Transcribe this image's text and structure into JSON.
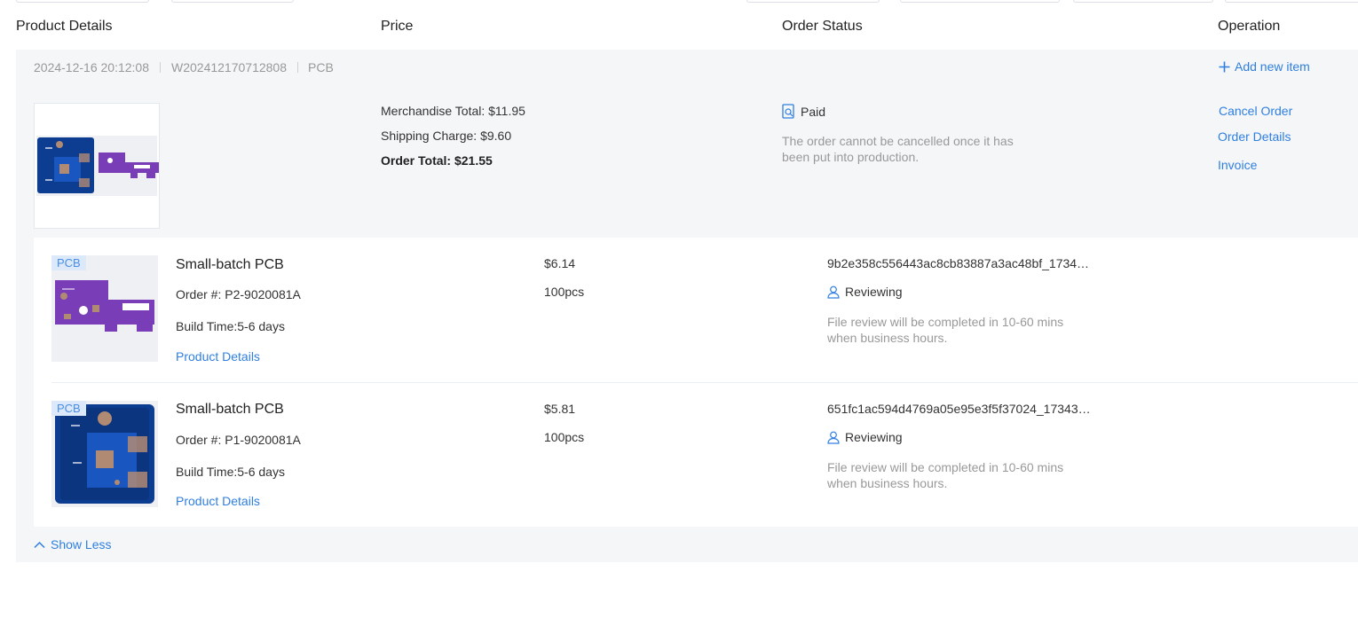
{
  "columns": {
    "product": "Product Details",
    "price": "Price",
    "status": "Order Status",
    "operation": "Operation"
  },
  "order": {
    "datetime": "2024-12-16 20:12:08",
    "number": "W202412170712808",
    "category": "PCB",
    "add_item": "Add new item",
    "merch_total": "Merchandise Total: $11.95",
    "shipping": "Shipping Charge: $9.60",
    "order_total": "Order Total: $21.55",
    "status": "Paid",
    "status_note": "The order cannot be cancelled once it has been put into production.",
    "ops": {
      "cancel": "Cancel Order",
      "details": "Order Details",
      "invoice": "Invoice"
    }
  },
  "items": [
    {
      "badge": "PCB",
      "title": "Small-batch PCB",
      "order_no": "Order #: P2-9020081A",
      "build_time": "Build Time:5-6 days",
      "details_link": "Product Details",
      "price": "$6.14",
      "qty": "100pcs",
      "file": "9b2e358c556443ac8cb83887a3ac48bf_1734…",
      "status": "Reviewing",
      "note": "File review will be completed in 10-60 mins when business hours.",
      "board_color": "#7a3db8"
    },
    {
      "badge": "PCB",
      "title": "Small-batch PCB",
      "order_no": "Order #: P1-9020081A",
      "build_time": "Build Time:5-6 days",
      "details_link": "Product Details",
      "price": "$5.81",
      "qty": "100pcs",
      "file": "651fc1ac594d4769a05e95e3f5f37024_17343…",
      "status": "Reviewing",
      "note": "File review will be completed in 10-60 mins when business hours.",
      "board_color": "#0d3d91"
    }
  ],
  "show_less": "Show Less",
  "colors": {
    "link": "#2f7fe0",
    "muted": "#999999",
    "block_bg": "#f4f6f8"
  },
  "icons": [
    "plus-icon",
    "paid-doc-icon",
    "reviewer-icon",
    "chevron-up-icon"
  ]
}
